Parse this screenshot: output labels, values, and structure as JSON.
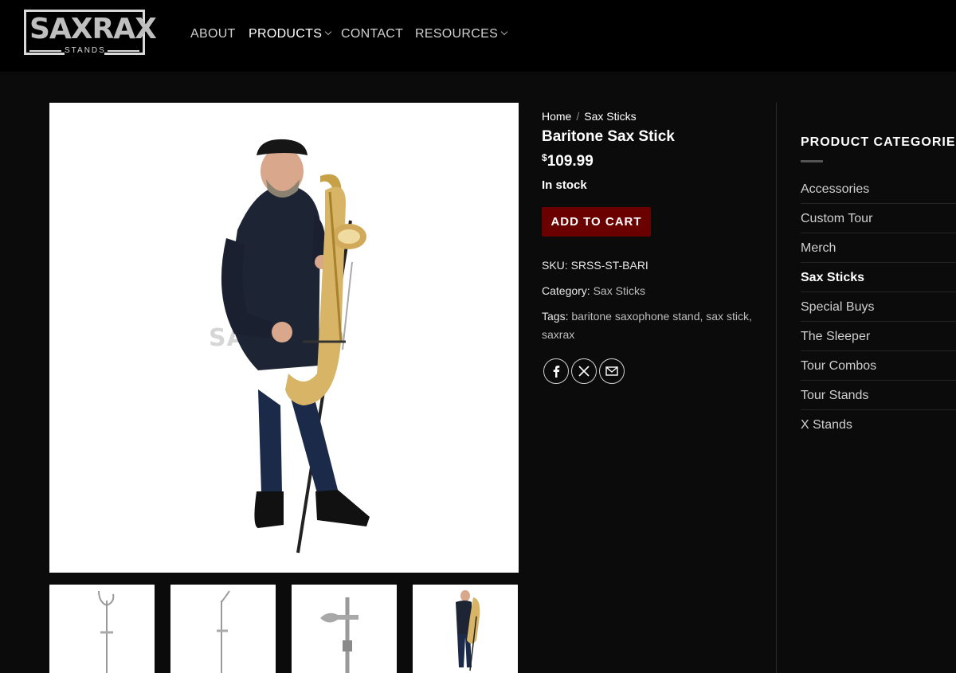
{
  "header": {
    "logo_text": "SAXRAX",
    "logo_sub": "STANDS",
    "nav": [
      {
        "label": "ABOUT"
      },
      {
        "label": "PRODUCTS"
      },
      {
        "label": "CONTACT"
      },
      {
        "label": "RESOURCES"
      }
    ]
  },
  "gallery": {
    "watermark": "SAXRAX®"
  },
  "product": {
    "breadcrumb": [
      "Home",
      "/",
      "Sax Sticks"
    ],
    "title": "Baritone Sax Stick",
    "currency": "$",
    "price": "109.99",
    "stock": "In stock",
    "cart_label": "ADD TO CART",
    "sku_label": "SKU:",
    "sku": "SRSS-ST-BARI",
    "category_label": "Category:",
    "category": "Sax Sticks",
    "tags_label": "Tags:",
    "tags_line1": "baritone saxophone stand, sax stick,",
    "tags_line2": "saxrax"
  },
  "sidebar": {
    "title": "PRODUCT CATEGORIES",
    "items": [
      {
        "label": "Accessories"
      },
      {
        "label": "Custom Tour"
      },
      {
        "label": "Merch"
      },
      {
        "label": "Sax Sticks"
      },
      {
        "label": "Special Buys"
      },
      {
        "label": "The Sleeper"
      },
      {
        "label": "Tour Combos"
      },
      {
        "label": "Tour Stands"
      },
      {
        "label": "X Stands"
      }
    ]
  },
  "colors": {
    "page_bg": "#0b0b0b",
    "header_bg": "#000000",
    "cart_button": "#6b0000"
  }
}
